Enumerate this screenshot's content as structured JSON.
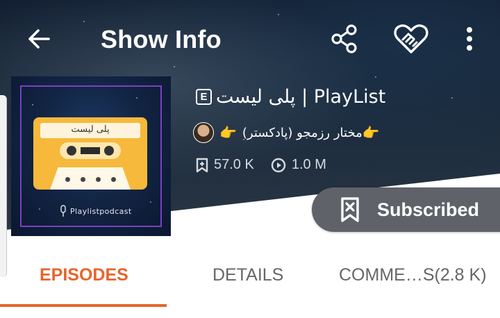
{
  "header": {
    "title": "Show Info",
    "icons": [
      "back-arrow-icon",
      "share-icon",
      "heart-handshake-icon",
      "more-vertical-icon"
    ]
  },
  "show": {
    "title": "پلی لیست | PlayList",
    "explicit_badge": "E",
    "cover_label": "پلی لیست",
    "cover_caption": "Playlistpodcast",
    "author": "مختار رزمجو (پادکستر)",
    "author_emoji": "👉",
    "subscribers": "57.0 K",
    "plays": "1.0 M"
  },
  "subscribe": {
    "label": "Subscribed"
  },
  "tabs": [
    {
      "label": "EPISODES",
      "active": true
    },
    {
      "label": "DETAILS",
      "active": false
    },
    {
      "label": "COMME…S(2.8 K)",
      "active": false
    }
  ],
  "colors": {
    "accent": "#e8642c",
    "subscribed_bg": "#5f6268",
    "hero_bg": "#1a2838"
  }
}
